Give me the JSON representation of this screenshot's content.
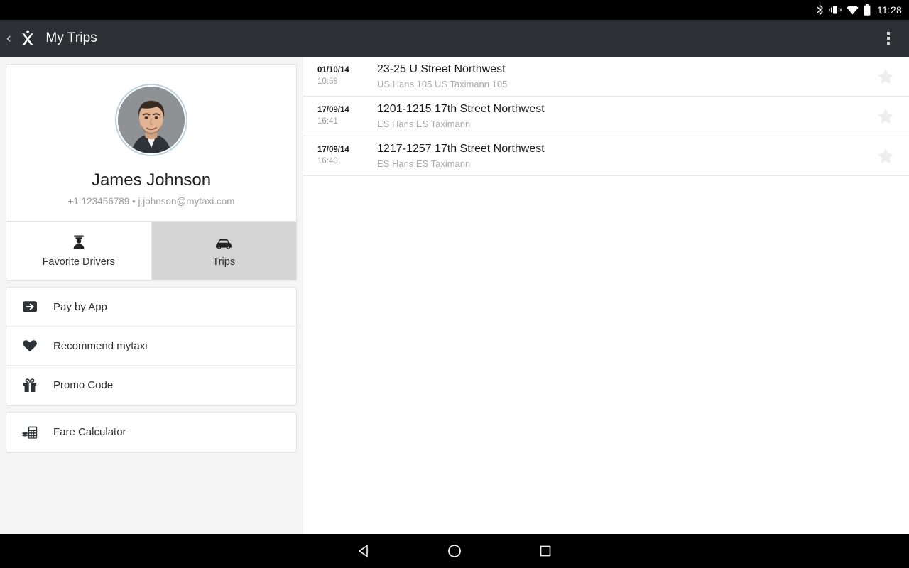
{
  "status_bar": {
    "icons": [
      "bluetooth-icon",
      "vibrate-icon",
      "wifi-icon",
      "battery-icon"
    ],
    "clock": "11:28"
  },
  "action_bar": {
    "back_label": "‹",
    "logo_name": "mytaxi-x-logo",
    "title": "My Trips",
    "overflow_name": "overflow-menu-icon"
  },
  "profile": {
    "avatar_name": "user-avatar",
    "name": "James Johnson",
    "contact": "+1 123456789 • j.johnson@mytaxi.com"
  },
  "tabs": [
    {
      "label": "Favorite Drivers",
      "icon": "driver-icon",
      "selected": false
    },
    {
      "label": "Trips",
      "icon": "taxi-icon",
      "selected": true
    }
  ],
  "menu_groups": [
    {
      "items": [
        {
          "label": "Pay by App",
          "icon": "pay-by-app-icon"
        },
        {
          "label": "Recommend mytaxi",
          "icon": "heart-icon"
        },
        {
          "label": "Promo Code",
          "icon": "gift-icon"
        }
      ]
    },
    {
      "items": [
        {
          "label": "Fare Calculator",
          "icon": "calculator-icon"
        }
      ]
    }
  ],
  "trips": [
    {
      "date": "01/10/14",
      "time": "10:58",
      "title": "23-25 U Street Northwest",
      "subtitle": "US Hans 105 US Taximann 105",
      "star": "star-icon"
    },
    {
      "date": "17/09/14",
      "time": "16:41",
      "title": "1201-1215 17th Street Northwest",
      "subtitle": "ES Hans ES Taximann",
      "star": "star-icon"
    },
    {
      "date": "17/09/14",
      "time": "16:40",
      "title": "1217-1257 17th Street Northwest",
      "subtitle": "ES Hans ES Taximann",
      "star": "star-icon"
    }
  ],
  "nav_bar": {
    "back": "back-triangle-icon",
    "home": "home-circle-icon",
    "recents": "recents-square-icon"
  },
  "colors": {
    "action_bar": "#2d3135",
    "panel_bg": "#f5f5f5",
    "selected_tab": "#d4d4d4",
    "avatar_ring": "#bdd3de",
    "star": "#ededed"
  }
}
